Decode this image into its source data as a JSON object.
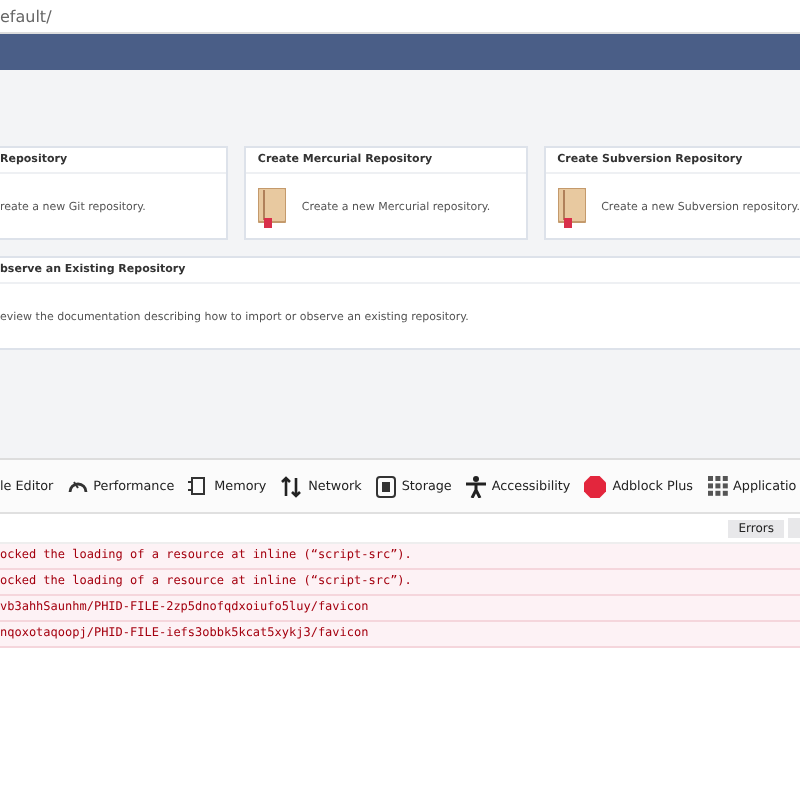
{
  "address_bar": {
    "url": "efault/"
  },
  "create_cards": [
    {
      "title": "Repository",
      "description": "reate a new Git repository.",
      "icon": false
    },
    {
      "title": "Create Mercurial Repository",
      "description": "Create a new Mercurial repository.",
      "icon": true
    },
    {
      "title": "Create Subversion Repository",
      "description": "Create a new Subversion repository.",
      "icon": true
    }
  ],
  "observe_card": {
    "title": "bserve an Existing Repository",
    "description": "eview the documentation describing how to import or observe an existing repository."
  },
  "devtools": {
    "tabs": [
      {
        "label": "le Editor",
        "kind": "none",
        "selected": false
      },
      {
        "label": "Performance",
        "kind": "gauge",
        "selected": false
      },
      {
        "label": "Memory",
        "kind": "chip",
        "selected": false
      },
      {
        "label": "Network",
        "kind": "arrows",
        "selected": false
      },
      {
        "label": "Storage",
        "kind": "storage",
        "selected": false
      },
      {
        "label": "Accessibility",
        "kind": "person",
        "selected": false
      },
      {
        "label": "Adblock Plus",
        "kind": "adblock",
        "selected": false
      },
      {
        "label": "Applicatio",
        "kind": "grid",
        "selected": false
      }
    ],
    "filter_button": "Errors",
    "messages": [
      "ocked the loading of a resource at inline (“script-src”).",
      "ocked the loading of a resource at inline (“script-src”).",
      "vb3ahhSaunhm/PHID-FILE-2zp5dnofqdxoiufo5luy/favicon",
      "nqoxotaqoopj/PHID-FILE-iefs3obbk5kcat5xykj3/favicon"
    ]
  }
}
